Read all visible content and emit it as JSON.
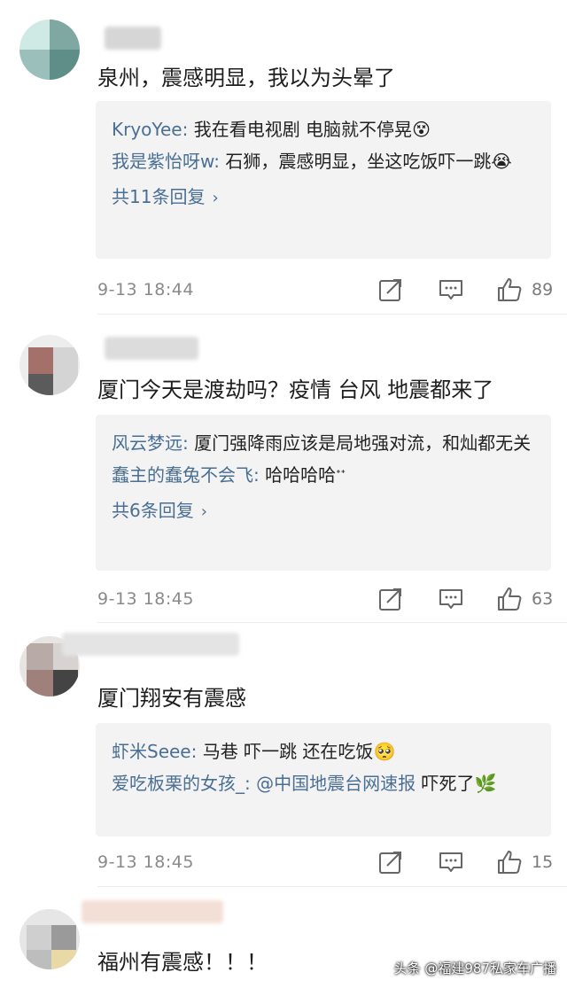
{
  "comments": [
    {
      "text": "泉州，震感明显，我以为头晕了",
      "replies": [
        {
          "name": "KryoYee",
          "sep": ": ",
          "content": "我在看电视剧 电脑就不停晃",
          "emoji": "😵"
        },
        {
          "name": "我是紫怡呀w",
          "sep": ": ",
          "content": "石狮，震感明显，坐这吃饭吓一跳",
          "emoji": "😭"
        }
      ],
      "more": "共11条回复",
      "time": "9-13 18:44",
      "likes": "89"
    },
    {
      "text": "厦门今天是渡劫吗？疫情 台风 地震都来了",
      "replies": [
        {
          "name": "风云梦远",
          "sep": ": ",
          "content": "厦门强降雨应该是局地强对流，和灿都无关",
          "emoji": ""
        },
        {
          "name": "蠢主的蠢兔不会飞",
          "sep": ": ",
          "content": "哈哈哈哈",
          "emoji": "ᕀᕀ"
        }
      ],
      "more": "共6条回复",
      "time": "9-13 18:45",
      "likes": "63"
    },
    {
      "text": "厦门翔安有震感",
      "replies": [
        {
          "name": "虾米Seee",
          "sep": ": ",
          "content": "马巷 吓一跳 还在吃饭",
          "emoji": "🥺"
        },
        {
          "name": "爱吃板栗的女孩_",
          "sep": ": ",
          "mention": "@中国地震台网速报",
          "content": " 吓死了",
          "emoji": "🌿"
        }
      ],
      "more": "",
      "time": "9-13 18:45",
      "likes": "15"
    },
    {
      "text": "福州有震感！！！"
    }
  ],
  "watermark": "头条 @福建987私家车广播",
  "icons": {
    "share": "share-icon",
    "comment": "comment-icon",
    "like": "thumbs-up-icon",
    "chevron": "chevron-right-icon"
  }
}
